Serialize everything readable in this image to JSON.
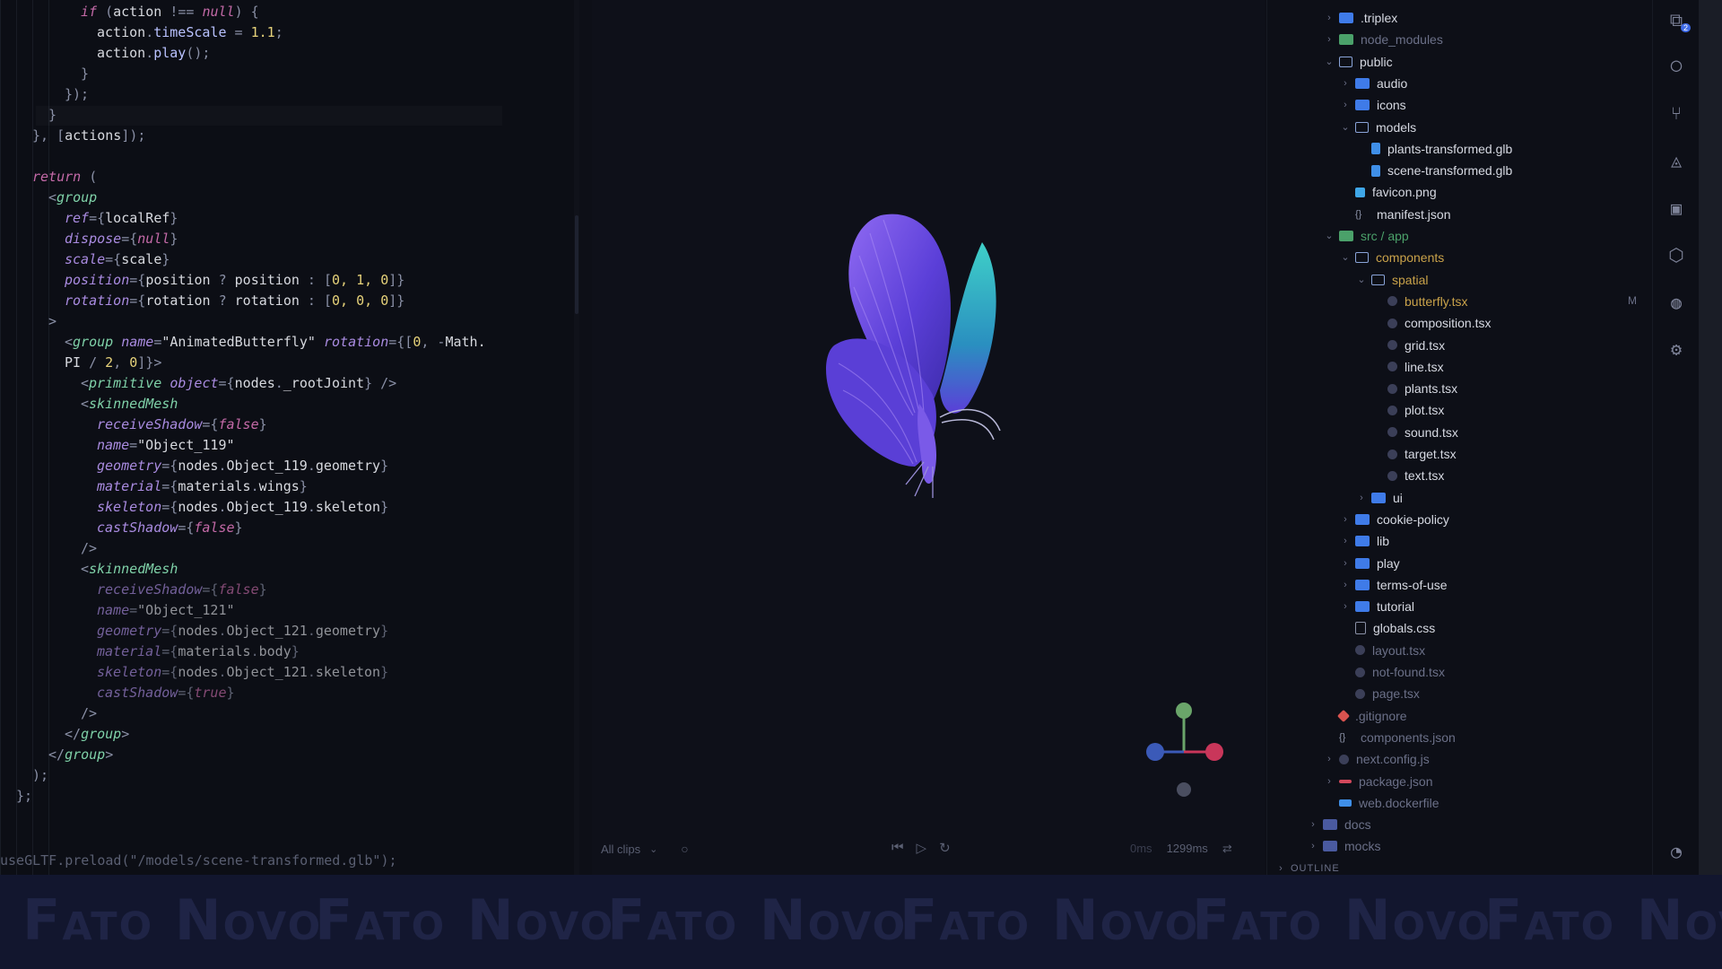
{
  "editor": {
    "lines": [
      [
        [
          "tk-kw",
          "if"
        ],
        [
          "tk-punct",
          " ("
        ],
        [
          "tk-str",
          "action "
        ],
        [
          "tk-punct",
          "!== "
        ],
        [
          "tk-kw",
          "null"
        ],
        [
          "tk-punct",
          ") {"
        ]
      ],
      [
        [
          "tk-str",
          "action"
        ],
        [
          "tk-punct",
          "."
        ],
        [
          "tk-fn",
          "timeScale"
        ],
        [
          "tk-punct",
          " = "
        ],
        [
          "tk-num",
          "1.1"
        ],
        [
          "tk-punct",
          ";"
        ]
      ],
      [
        [
          "tk-str",
          "action"
        ],
        [
          "tk-punct",
          "."
        ],
        [
          "tk-fn",
          "play"
        ],
        [
          "tk-punct",
          "();"
        ]
      ],
      [
        [
          "tk-punct",
          "}"
        ]
      ],
      [
        [
          "tk-punct",
          "});"
        ]
      ],
      [
        [
          "tk-punct",
          "}"
        ]
      ],
      [
        [
          "tk-punct",
          "}, ["
        ],
        [
          "tk-str",
          "actions"
        ],
        [
          "tk-punct",
          "]);"
        ]
      ],
      [
        [
          "tk-punct",
          ""
        ]
      ],
      [
        [
          "tk-kw",
          "return"
        ],
        [
          "tk-punct",
          " ("
        ]
      ],
      [
        [
          "tk-punct",
          "<"
        ],
        [
          "tk-tag",
          "group"
        ]
      ],
      [
        [
          "tk-attr",
          "ref"
        ],
        [
          "tk-punct",
          "={"
        ],
        [
          "tk-str",
          "localRef"
        ],
        [
          "tk-punct",
          "}"
        ]
      ],
      [
        [
          "tk-attr",
          "dispose"
        ],
        [
          "tk-punct",
          "={"
        ],
        [
          "tk-kw",
          "null"
        ],
        [
          "tk-punct",
          "}"
        ]
      ],
      [
        [
          "tk-attr",
          "scale"
        ],
        [
          "tk-punct",
          "={"
        ],
        [
          "tk-str",
          "scale"
        ],
        [
          "tk-punct",
          "}"
        ]
      ],
      [
        [
          "tk-attr",
          "position"
        ],
        [
          "tk-punct",
          "={"
        ],
        [
          "tk-str",
          "position"
        ],
        [
          "tk-punct",
          " ? "
        ],
        [
          "tk-str",
          "position"
        ],
        [
          "tk-punct",
          " : ["
        ],
        [
          "tk-num",
          "0, 1, 0"
        ],
        [
          "tk-punct",
          "]}"
        ]
      ],
      [
        [
          "tk-attr",
          "rotation"
        ],
        [
          "tk-punct",
          "={"
        ],
        [
          "tk-str",
          "rotation"
        ],
        [
          "tk-punct",
          " ? "
        ],
        [
          "tk-str",
          "rotation"
        ],
        [
          "tk-punct",
          " : ["
        ],
        [
          "tk-num",
          "0, 0, 0"
        ],
        [
          "tk-punct",
          "]}"
        ]
      ],
      [
        [
          "tk-punct",
          ">"
        ]
      ],
      [
        [
          "tk-punct",
          "<"
        ],
        [
          "tk-tag",
          "group"
        ],
        [
          "tk-attr",
          " name"
        ],
        [
          "tk-punct",
          "="
        ],
        [
          "tk-str",
          "\"AnimatedButterfly\""
        ],
        [
          "tk-attr",
          " rotation"
        ],
        [
          "tk-punct",
          "={["
        ],
        [
          "tk-num",
          "0"
        ],
        [
          "tk-punct",
          ", -"
        ],
        [
          "tk-str",
          "Math."
        ]
      ],
      [
        [
          "tk-str",
          "PI"
        ],
        [
          "tk-punct",
          " / "
        ],
        [
          "tk-num",
          "2"
        ],
        [
          "tk-punct",
          ", "
        ],
        [
          "tk-num",
          "0"
        ],
        [
          "tk-punct",
          "]}>"
        ]
      ],
      [
        [
          "tk-punct",
          "<"
        ],
        [
          "tk-tag",
          "primitive"
        ],
        [
          "tk-attr",
          " object"
        ],
        [
          "tk-punct",
          "={"
        ],
        [
          "tk-str",
          "nodes"
        ],
        [
          "tk-punct",
          "."
        ],
        [
          "tk-str",
          "_rootJoint"
        ],
        [
          "tk-punct",
          "} />"
        ]
      ],
      [
        [
          "tk-punct",
          "<"
        ],
        [
          "tk-tag",
          "skinnedMesh"
        ]
      ],
      [
        [
          "tk-attr",
          "receiveShadow"
        ],
        [
          "tk-punct",
          "={"
        ],
        [
          "tk-kw",
          "false"
        ],
        [
          "tk-punct",
          "}"
        ]
      ],
      [
        [
          "tk-attr",
          "name"
        ],
        [
          "tk-punct",
          "="
        ],
        [
          "tk-str",
          "\"Object_119\""
        ]
      ],
      [
        [
          "tk-attr",
          "geometry"
        ],
        [
          "tk-punct",
          "={"
        ],
        [
          "tk-str",
          "nodes"
        ],
        [
          "tk-punct",
          "."
        ],
        [
          "tk-str",
          "Object_119"
        ],
        [
          "tk-punct",
          "."
        ],
        [
          "tk-str",
          "geometry"
        ],
        [
          "tk-punct",
          "}"
        ]
      ],
      [
        [
          "tk-attr",
          "material"
        ],
        [
          "tk-punct",
          "={"
        ],
        [
          "tk-str",
          "materials"
        ],
        [
          "tk-punct",
          "."
        ],
        [
          "tk-str",
          "wings"
        ],
        [
          "tk-punct",
          "}"
        ]
      ],
      [
        [
          "tk-attr",
          "skeleton"
        ],
        [
          "tk-punct",
          "={"
        ],
        [
          "tk-str",
          "nodes"
        ],
        [
          "tk-punct",
          "."
        ],
        [
          "tk-str",
          "Object_119"
        ],
        [
          "tk-punct",
          "."
        ],
        [
          "tk-str",
          "skeleton"
        ],
        [
          "tk-punct",
          "}"
        ]
      ],
      [
        [
          "tk-attr",
          "castShadow"
        ],
        [
          "tk-punct",
          "={"
        ],
        [
          "tk-kw",
          "false"
        ],
        [
          "tk-punct",
          "}"
        ]
      ],
      [
        [
          "tk-punct",
          "/>"
        ]
      ],
      [
        [
          "tk-punct",
          "<"
        ],
        [
          "tk-tag",
          "skinnedMesh"
        ]
      ],
      [
        [
          "tk-attr",
          "receiveShadow"
        ],
        [
          "tk-punct",
          "={"
        ],
        [
          "tk-kw",
          "false"
        ],
        [
          "tk-punct",
          "}"
        ]
      ],
      [
        [
          "tk-attr",
          "name"
        ],
        [
          "tk-punct",
          "="
        ],
        [
          "tk-str",
          "\"Object_121\""
        ]
      ],
      [
        [
          "tk-attr",
          "geometry"
        ],
        [
          "tk-punct",
          "={"
        ],
        [
          "tk-str",
          "nodes"
        ],
        [
          "tk-punct",
          "."
        ],
        [
          "tk-str",
          "Object_121"
        ],
        [
          "tk-punct",
          "."
        ],
        [
          "tk-str",
          "geometry"
        ],
        [
          "tk-punct",
          "}"
        ]
      ],
      [
        [
          "tk-attr",
          "material"
        ],
        [
          "tk-punct",
          "={"
        ],
        [
          "tk-str",
          "materials"
        ],
        [
          "tk-punct",
          "."
        ],
        [
          "tk-str",
          "body"
        ],
        [
          "tk-punct",
          "}"
        ]
      ],
      [
        [
          "tk-attr",
          "skeleton"
        ],
        [
          "tk-punct",
          "={"
        ],
        [
          "tk-str",
          "nodes"
        ],
        [
          "tk-punct",
          "."
        ],
        [
          "tk-str",
          "Object_121"
        ],
        [
          "tk-punct",
          "."
        ],
        [
          "tk-str",
          "skeleton"
        ],
        [
          "tk-punct",
          "}"
        ]
      ],
      [
        [
          "tk-attr",
          "castShadow"
        ],
        [
          "tk-punct",
          "={"
        ],
        [
          "tk-kw",
          "true"
        ],
        [
          "tk-punct",
          "}"
        ]
      ],
      [
        [
          "tk-punct",
          "/>"
        ]
      ],
      [
        [
          "tk-punct",
          "</"
        ],
        [
          "tk-tag",
          "group"
        ],
        [
          "tk-punct",
          ">"
        ]
      ],
      [
        [
          "tk-punct",
          "</"
        ],
        [
          "tk-tag",
          "group"
        ],
        [
          "tk-punct",
          ">"
        ]
      ],
      [
        [
          "tk-punct",
          ");"
        ]
      ],
      [
        [
          "tk-punct",
          "};"
        ]
      ],
      [
        [
          "tk-punct",
          ""
        ]
      ],
      [
        [
          "tk-dim",
          "useGLTF.preload(\"/models/scene-transformed.glb\");"
        ]
      ]
    ]
  },
  "timeline": {
    "clips_select": "All clips",
    "time_start": "0ms",
    "time_end": "1299ms"
  },
  "explorer": {
    "items": [
      {
        "label": ".triplex",
        "icon": "folder",
        "chev": "›",
        "dim": false
      },
      {
        "label": "node_modules",
        "icon": "folder-green",
        "chev": "›",
        "dim": true
      },
      {
        "label": "public",
        "icon": "folder-open",
        "chev": "⌄",
        "dim": false
      },
      {
        "label": "audio",
        "icon": "folder",
        "chev": "›",
        "dim": false
      },
      {
        "label": "icons",
        "icon": "folder",
        "chev": "›",
        "dim": false
      },
      {
        "label": "models",
        "icon": "folder-open",
        "chev": "⌄",
        "dim": false
      },
      {
        "label": "plants-transformed.glb",
        "icon": "file-blue",
        "chev": "",
        "dim": false
      },
      {
        "label": "scene-transformed.glb",
        "icon": "file-blue",
        "chev": "",
        "dim": false
      },
      {
        "label": "favicon.png",
        "icon": "file-img",
        "chev": "",
        "dim": false
      },
      {
        "label": "manifest.json",
        "icon": "file-json",
        "chev": "",
        "dim": false
      },
      {
        "label": "src / app",
        "icon": "folder-green",
        "chev": "⌄",
        "dim": false,
        "accent": "#4ba16a"
      },
      {
        "label": "components",
        "icon": "folder-open",
        "chev": "⌄",
        "dim": false,
        "accent": "#c9a24a"
      },
      {
        "label": "spatial",
        "icon": "folder-open",
        "chev": "⌄",
        "dim": false,
        "accent": "#c9a24a"
      },
      {
        "label": "butterfly.tsx",
        "icon": "file-tsx",
        "chev": "",
        "dim": false,
        "accent": "#c9a24a",
        "badge": "M"
      },
      {
        "label": "composition.tsx",
        "icon": "file-tsx",
        "chev": "",
        "dim": false
      },
      {
        "label": "grid.tsx",
        "icon": "file-tsx",
        "chev": "",
        "dim": false
      },
      {
        "label": "line.tsx",
        "icon": "file-tsx",
        "chev": "",
        "dim": false
      },
      {
        "label": "plants.tsx",
        "icon": "file-tsx",
        "chev": "",
        "dim": false
      },
      {
        "label": "plot.tsx",
        "icon": "file-tsx",
        "chev": "",
        "dim": false
      },
      {
        "label": "sound.tsx",
        "icon": "file-tsx",
        "chev": "",
        "dim": false
      },
      {
        "label": "target.tsx",
        "icon": "file-tsx",
        "chev": "",
        "dim": false
      },
      {
        "label": "text.tsx",
        "icon": "file-tsx",
        "chev": "",
        "dim": false
      },
      {
        "label": "ui",
        "icon": "folder",
        "chev": "›",
        "dim": false
      },
      {
        "label": "cookie-policy",
        "icon": "folder",
        "chev": "›",
        "dim": false
      },
      {
        "label": "lib",
        "icon": "folder",
        "chev": "›",
        "dim": false
      },
      {
        "label": "play",
        "icon": "folder",
        "chev": "›",
        "dim": false
      },
      {
        "label": "terms-of-use",
        "icon": "folder",
        "chev": "›",
        "dim": false
      },
      {
        "label": "tutorial",
        "icon": "folder",
        "chev": "›",
        "dim": false
      },
      {
        "label": "globals.css",
        "icon": "file-css",
        "chev": "",
        "dim": false
      },
      {
        "label": "layout.tsx",
        "icon": "file-tsx",
        "chev": "",
        "dim": true
      },
      {
        "label": "not-found.tsx",
        "icon": "file-tsx",
        "chev": "",
        "dim": true
      },
      {
        "label": "page.tsx",
        "icon": "file-tsx",
        "chev": "",
        "dim": true
      },
      {
        "label": ".gitignore",
        "icon": "file-git",
        "chev": "",
        "dim": true
      },
      {
        "label": "components.json",
        "icon": "file-json",
        "chev": "",
        "dim": true
      },
      {
        "label": "next.config.js",
        "icon": "file-tsx",
        "chev": "›",
        "dim": true
      },
      {
        "label": "package.json",
        "icon": "file-pkg",
        "chev": "›",
        "dim": true
      },
      {
        "label": "web.dockerfile",
        "icon": "file-docker",
        "chev": "",
        "dim": true
      },
      {
        "label": "docs",
        "icon": "folder-muted",
        "chev": "›",
        "dim": true
      },
      {
        "label": "mocks",
        "icon": "folder-muted",
        "chev": "›",
        "dim": true
      },
      {
        "label": "OUTLINE",
        "icon": "",
        "chev": "›",
        "dim": true
      }
    ]
  },
  "activity_bar": {
    "icons": [
      "extensions-icon",
      "github-icon",
      "source-control-icon",
      "docker-icon",
      "remote-explorer-icon",
      "cube-icon",
      "globe-icon",
      "settings-icon",
      "account-icon"
    ],
    "extensions_badge": "2"
  },
  "watermark": {
    "text": "Fato Novo"
  },
  "colors": {
    "bg": "#0d0f17",
    "butterfly_primary": "#6a4de0",
    "butterfly_secondary": "#2bb8c9",
    "accent_modified": "#c9a24a",
    "folder_blue": "#3f7be8"
  }
}
